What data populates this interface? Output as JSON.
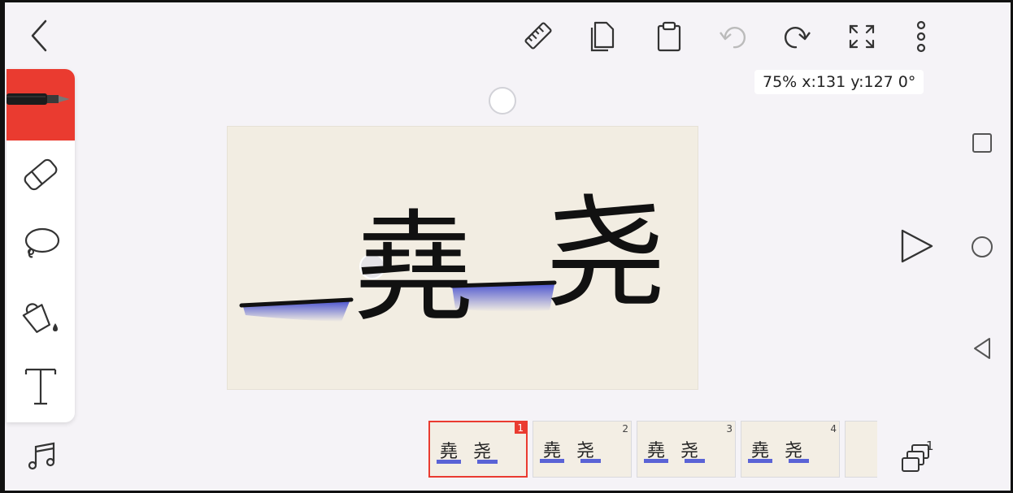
{
  "toolbar": {
    "icons": [
      "back-icon",
      "ruler-icon",
      "copy-icon",
      "paste-icon",
      "undo-icon",
      "redo-icon",
      "fullscreen-icon",
      "more-icon"
    ]
  },
  "status": {
    "zoom_position": "75% x:131 y:127 0°"
  },
  "tools": [
    "pen",
    "eraser",
    "lasso",
    "fill",
    "text"
  ],
  "colors": {
    "accent": "#ea3b30",
    "ink": "#111111",
    "water": "#5a63d6",
    "paper": "#f2ede2"
  },
  "canvas": {
    "glyphs": [
      "堯",
      "尧"
    ]
  },
  "frames": [
    {
      "number": "1",
      "active": true,
      "glyphs": "堯 尧"
    },
    {
      "number": "2",
      "active": false,
      "glyphs": "堯 尧"
    },
    {
      "number": "3",
      "active": false,
      "glyphs": "堯 尧"
    },
    {
      "number": "4",
      "active": false,
      "glyphs": "堯 尧"
    }
  ],
  "layers": {
    "count": "1"
  },
  "system_nav": [
    "recent-apps-icon",
    "home-icon",
    "back-nav-icon"
  ]
}
